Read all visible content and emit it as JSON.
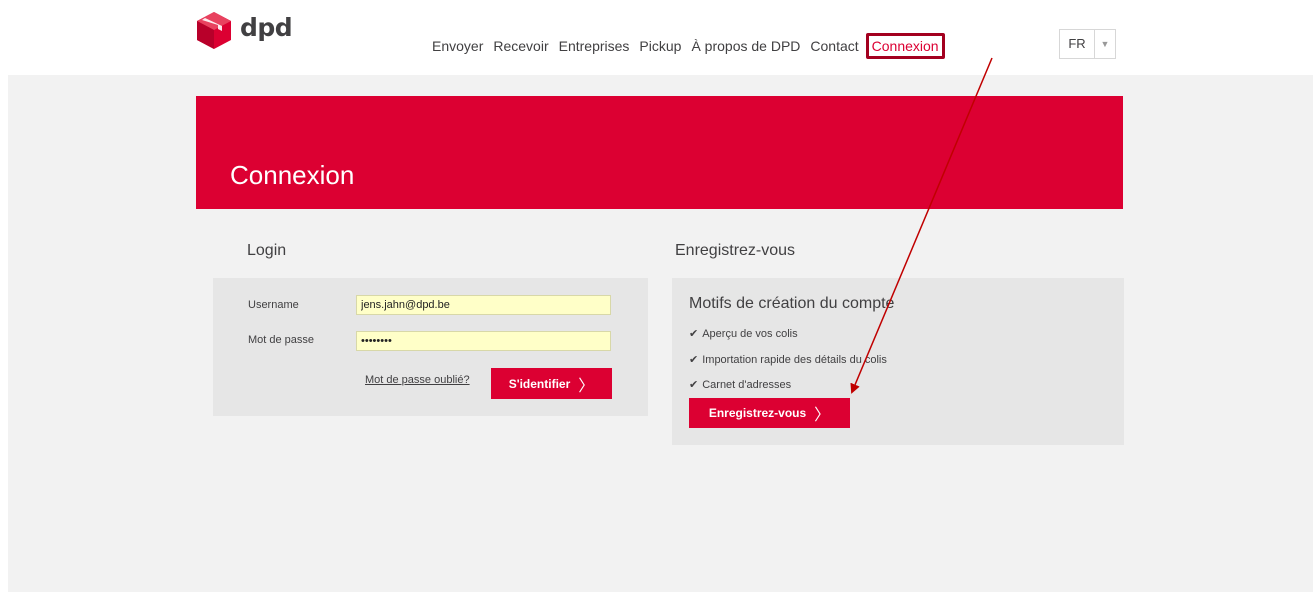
{
  "brand": {
    "logo_text": "dpd",
    "color_red": "#dc0032",
    "color_dark": "#414042"
  },
  "nav": {
    "items": [
      "Envoyer",
      "Recevoir",
      "Entreprises",
      "Pickup",
      "À propos de DPD",
      "Contact"
    ],
    "active": "Connexion",
    "lang": "FR"
  },
  "banner": {
    "title": "Connexion"
  },
  "login": {
    "title": "Login",
    "username_label": "Username",
    "username_value": "jens.jahn@dpd.be",
    "password_label": "Mot de passe",
    "password_value": "••••••••",
    "forgot_label": "Mot de passe oublié?",
    "submit_label": "S'identifier"
  },
  "register": {
    "title": "Enregistrez-vous",
    "heading": "Motifs de création du compte",
    "reasons": [
      "Aperçu de vos colis",
      "Importation rapide des détails du colis",
      "Carnet d'adresses"
    ],
    "button_label": "Enregistrez-vous"
  }
}
